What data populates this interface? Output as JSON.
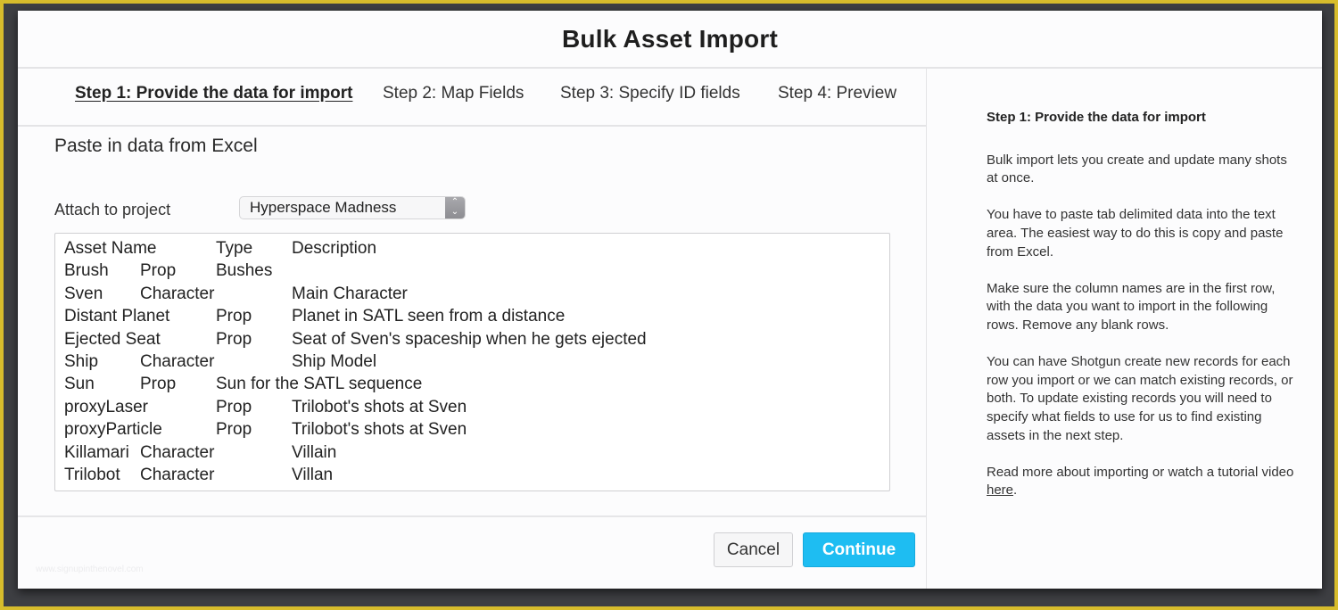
{
  "dialog": {
    "title": "Bulk Asset Import"
  },
  "steps": [
    {
      "label": "Step 1: Provide the data for import",
      "active": true
    },
    {
      "label": "Step 2: Map Fields",
      "active": false
    },
    {
      "label": "Step 3: Specify ID fields",
      "active": false
    },
    {
      "label": "Step 4: Preview",
      "active": false
    }
  ],
  "main": {
    "section_title": "Paste in data from Excel",
    "attach_label": "Attach to project",
    "project_select": {
      "value": "Hyperspace Madness"
    },
    "pasted_data": {
      "rows": [
        [
          "Asset Name",
          "Type",
          "Description"
        ],
        [
          "Brush",
          "Prop",
          "Bushes"
        ],
        [
          "Sven",
          "Character",
          "Main Character"
        ],
        [
          "Distant Planet",
          "Prop",
          "Planet in SATL seen from a distance"
        ],
        [
          "Ejected Seat",
          "Prop",
          "Seat of Sven's spaceship when he gets ejected"
        ],
        [
          "Ship",
          "Character",
          "Ship Model"
        ],
        [
          "Sun",
          "Prop",
          "Sun for the SATL sequence"
        ],
        [
          "proxyLaser",
          "Prop",
          "Trilobot's shots at Sven"
        ],
        [
          "proxyParticle",
          "Prop",
          "Trilobot's shots at Sven"
        ],
        [
          "Killamari",
          "Character",
          "Villain"
        ],
        [
          "Trilobot",
          "Character",
          "Villan"
        ]
      ]
    }
  },
  "footer": {
    "cancel_label": "Cancel",
    "continue_label": "Continue",
    "watermark": "www.signupinthenovel.com"
  },
  "help": {
    "title": "Step 1: Provide the data for import",
    "paragraphs": [
      "Bulk import lets you create and update many shots at once.",
      "You have to paste tab delimited data into the text area. The easiest way to do this is copy and paste from Excel.",
      "Make sure the column names are in the first row, with the data you want to import in the following rows. Remove any blank rows.",
      "You can have Shotgun create new records for each row you import or we can match existing records, or both. To update existing records you will need to specify what fields to use for us to find existing assets in the next step."
    ],
    "read_more_prefix": "Read more about importing or watch a tutorial video ",
    "read_more_link": "here",
    "read_more_suffix": "."
  },
  "colors": {
    "frame_yellow": "#d7bc2c",
    "frame_dark": "#3e3f43",
    "primary_button": "#1ebdf2"
  }
}
